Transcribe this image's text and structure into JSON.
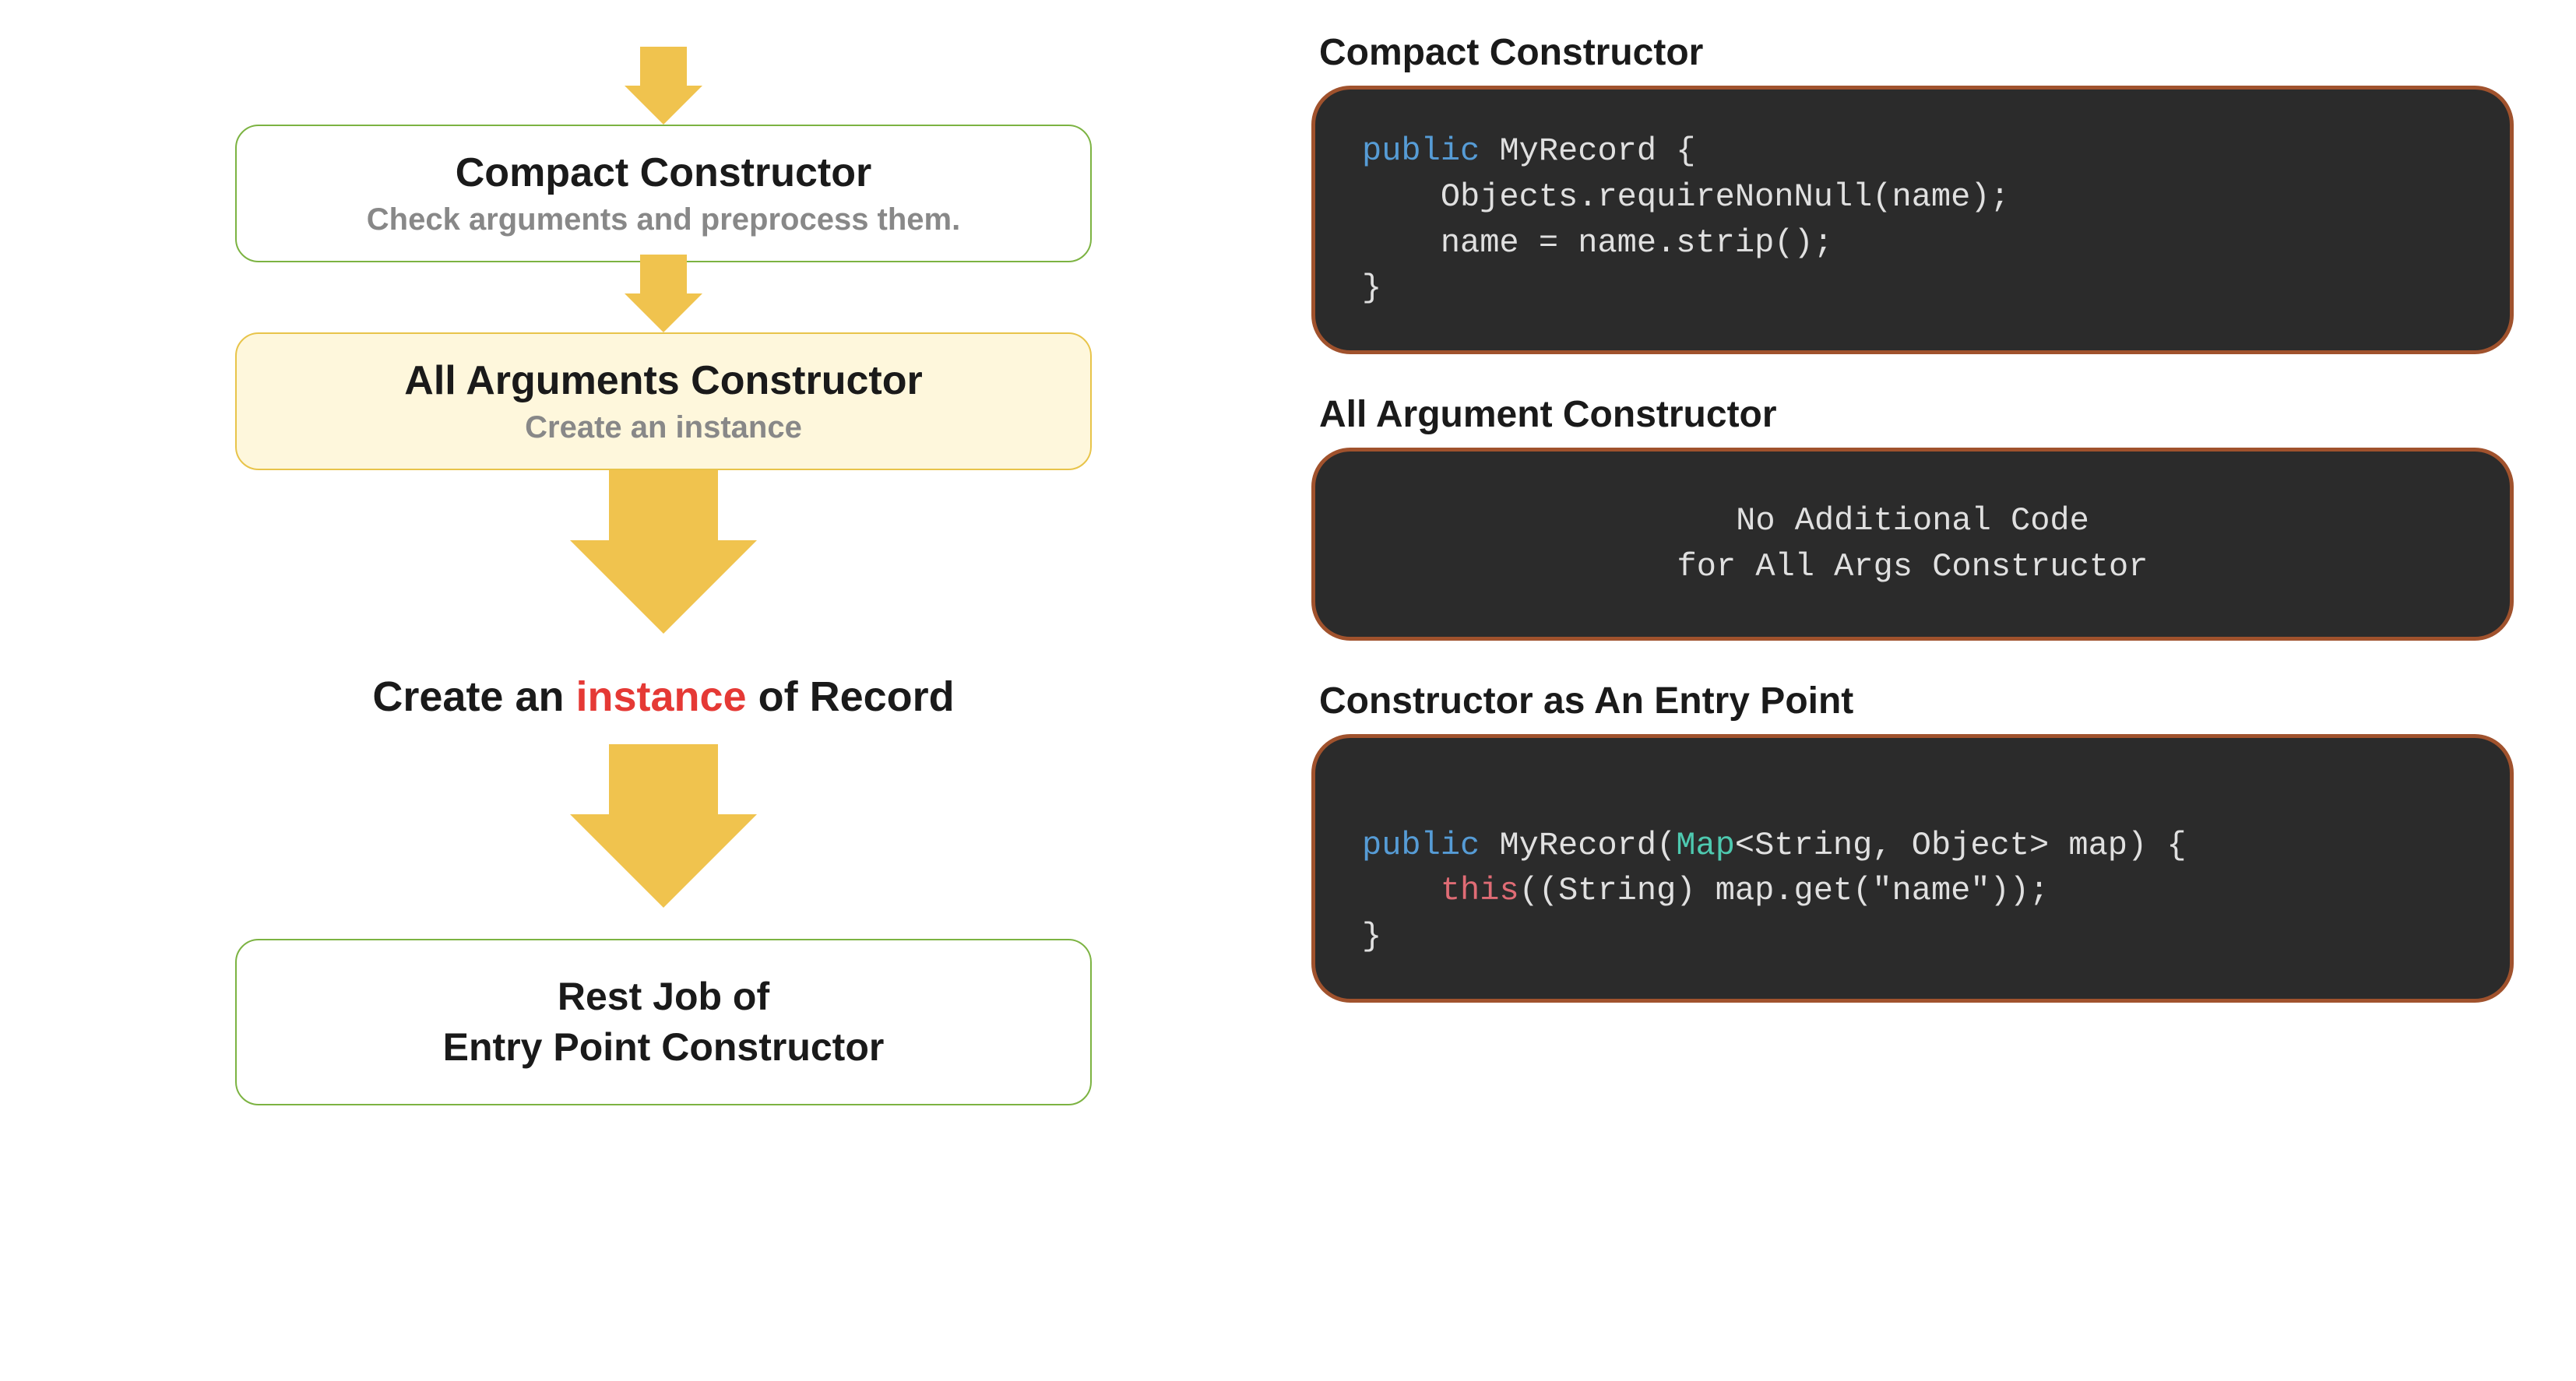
{
  "flow": {
    "compact": {
      "title": "Compact Constructor",
      "subtitle": "Check arguments and preprocess them."
    },
    "allArgs": {
      "title": "All Arguments Constructor",
      "subtitle": "Create an instance"
    },
    "instance": {
      "prefix": "Create an ",
      "highlight": "instance",
      "suffix": " of Record"
    },
    "rest": {
      "line1": "Rest Job of",
      "line2": "Entry Point Constructor"
    }
  },
  "code": {
    "compact": {
      "heading": "Compact Constructor",
      "kw": "public",
      "line1_rest": " MyRecord {",
      "line2": "    Objects.requireNonNull(name);",
      "line3": "    name = name.strip();",
      "line4": "}"
    },
    "allArg": {
      "heading": "All Argument Constructor",
      "line1": "No Additional Code",
      "line2": "for All Args Constructor"
    },
    "entry": {
      "heading": "Constructor as An Entry Point",
      "kw_public": "public",
      "after_public": " MyRecord(",
      "type_map": "Map",
      "after_map": "<String, Object> map) {",
      "indent2": "    ",
      "kw_this": "this",
      "after_this": "((String) map.get(\"name\"));",
      "line3": "}"
    }
  }
}
